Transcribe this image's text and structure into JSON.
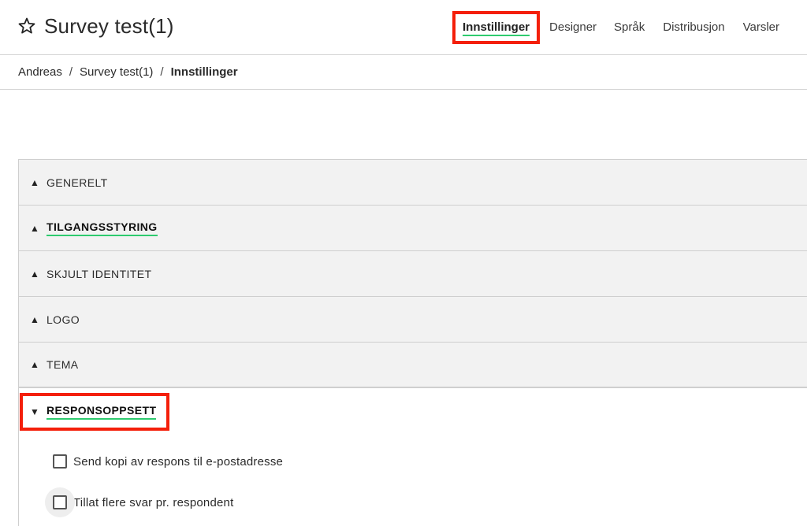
{
  "header": {
    "title": "Survey test(1)",
    "tabs": [
      "Innstillinger",
      "Designer",
      "Språk",
      "Distribusjon",
      "Varsler"
    ],
    "active_tab": "Innstillinger",
    "accent_color": "#2ecb6f",
    "highlight_color": "#f41f0a"
  },
  "breadcrumb": {
    "items": [
      "Andreas",
      "Survey test(1)",
      "Innstillinger"
    ],
    "separator": "/"
  },
  "accordion": {
    "sections": [
      {
        "label": "GENERELT",
        "arrow": "▲"
      },
      {
        "label": "TILGANGSSTYRING",
        "arrow": "▲"
      },
      {
        "label": "SKJULT IDENTITET",
        "arrow": "▲"
      },
      {
        "label": "LOGO",
        "arrow": "▲"
      },
      {
        "label": "TEMA",
        "arrow": "▲"
      }
    ],
    "open_section": {
      "label": "RESPONSOPPSETT",
      "arrow": "▼",
      "options": [
        {
          "label": "Send kopi av respons til e-postadresse",
          "checked": false
        },
        {
          "label": "Tillat flere svar pr. respondent",
          "checked": false
        }
      ]
    }
  }
}
